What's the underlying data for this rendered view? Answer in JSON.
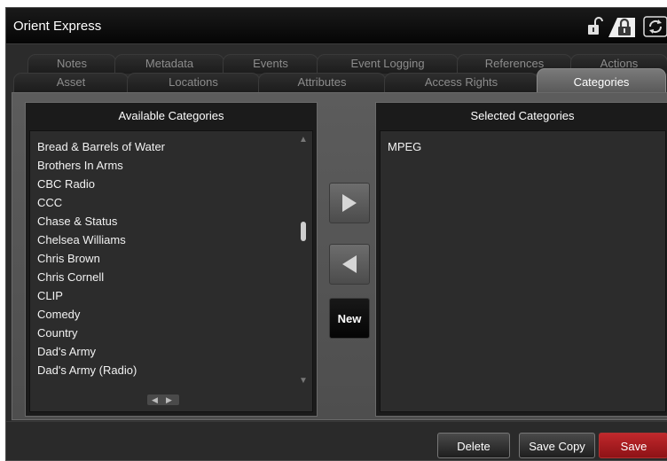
{
  "window": {
    "title": "Orient Express"
  },
  "titlebar_icons": [
    "padlock-unlocked-icon",
    "padlock-locked-icon",
    "refresh-icon"
  ],
  "tabs_back": [
    {
      "label": "Notes"
    },
    {
      "label": "Metadata"
    },
    {
      "label": "Events"
    },
    {
      "label": "Event Logging"
    },
    {
      "label": "References"
    },
    {
      "label": "Actions"
    }
  ],
  "tabs_front": [
    {
      "label": "Asset"
    },
    {
      "label": "Locations"
    },
    {
      "label": "Attributes"
    },
    {
      "label": "Access Rights"
    },
    {
      "label": "Categories",
      "active": true
    }
  ],
  "available": {
    "header": "Available Categories",
    "items": [
      "Bread & Barrels of Water",
      "Brothers In Arms",
      "CBC Radio",
      "CCC",
      "Chase & Status",
      "Chelsea Williams",
      "Chris Brown",
      "Chris Cornell",
      "CLIP",
      "Comedy",
      "Country",
      "Dad's Army",
      "Dad's Army (Radio)"
    ],
    "scroll_position": 0.36
  },
  "selected": {
    "header": "Selected Categories",
    "items": [
      "MPEG"
    ]
  },
  "middle": {
    "add_icon": "arrow-right-icon",
    "remove_icon": "arrow-left-icon",
    "new_label": "New"
  },
  "footer": {
    "delete_label": "Delete",
    "save_copy_label": "Save Copy",
    "save_label": "Save"
  },
  "colors": {
    "save_red": "#b0191e",
    "active_tab": "#6a6a6a",
    "panel_bg": "#1b1b1b"
  }
}
